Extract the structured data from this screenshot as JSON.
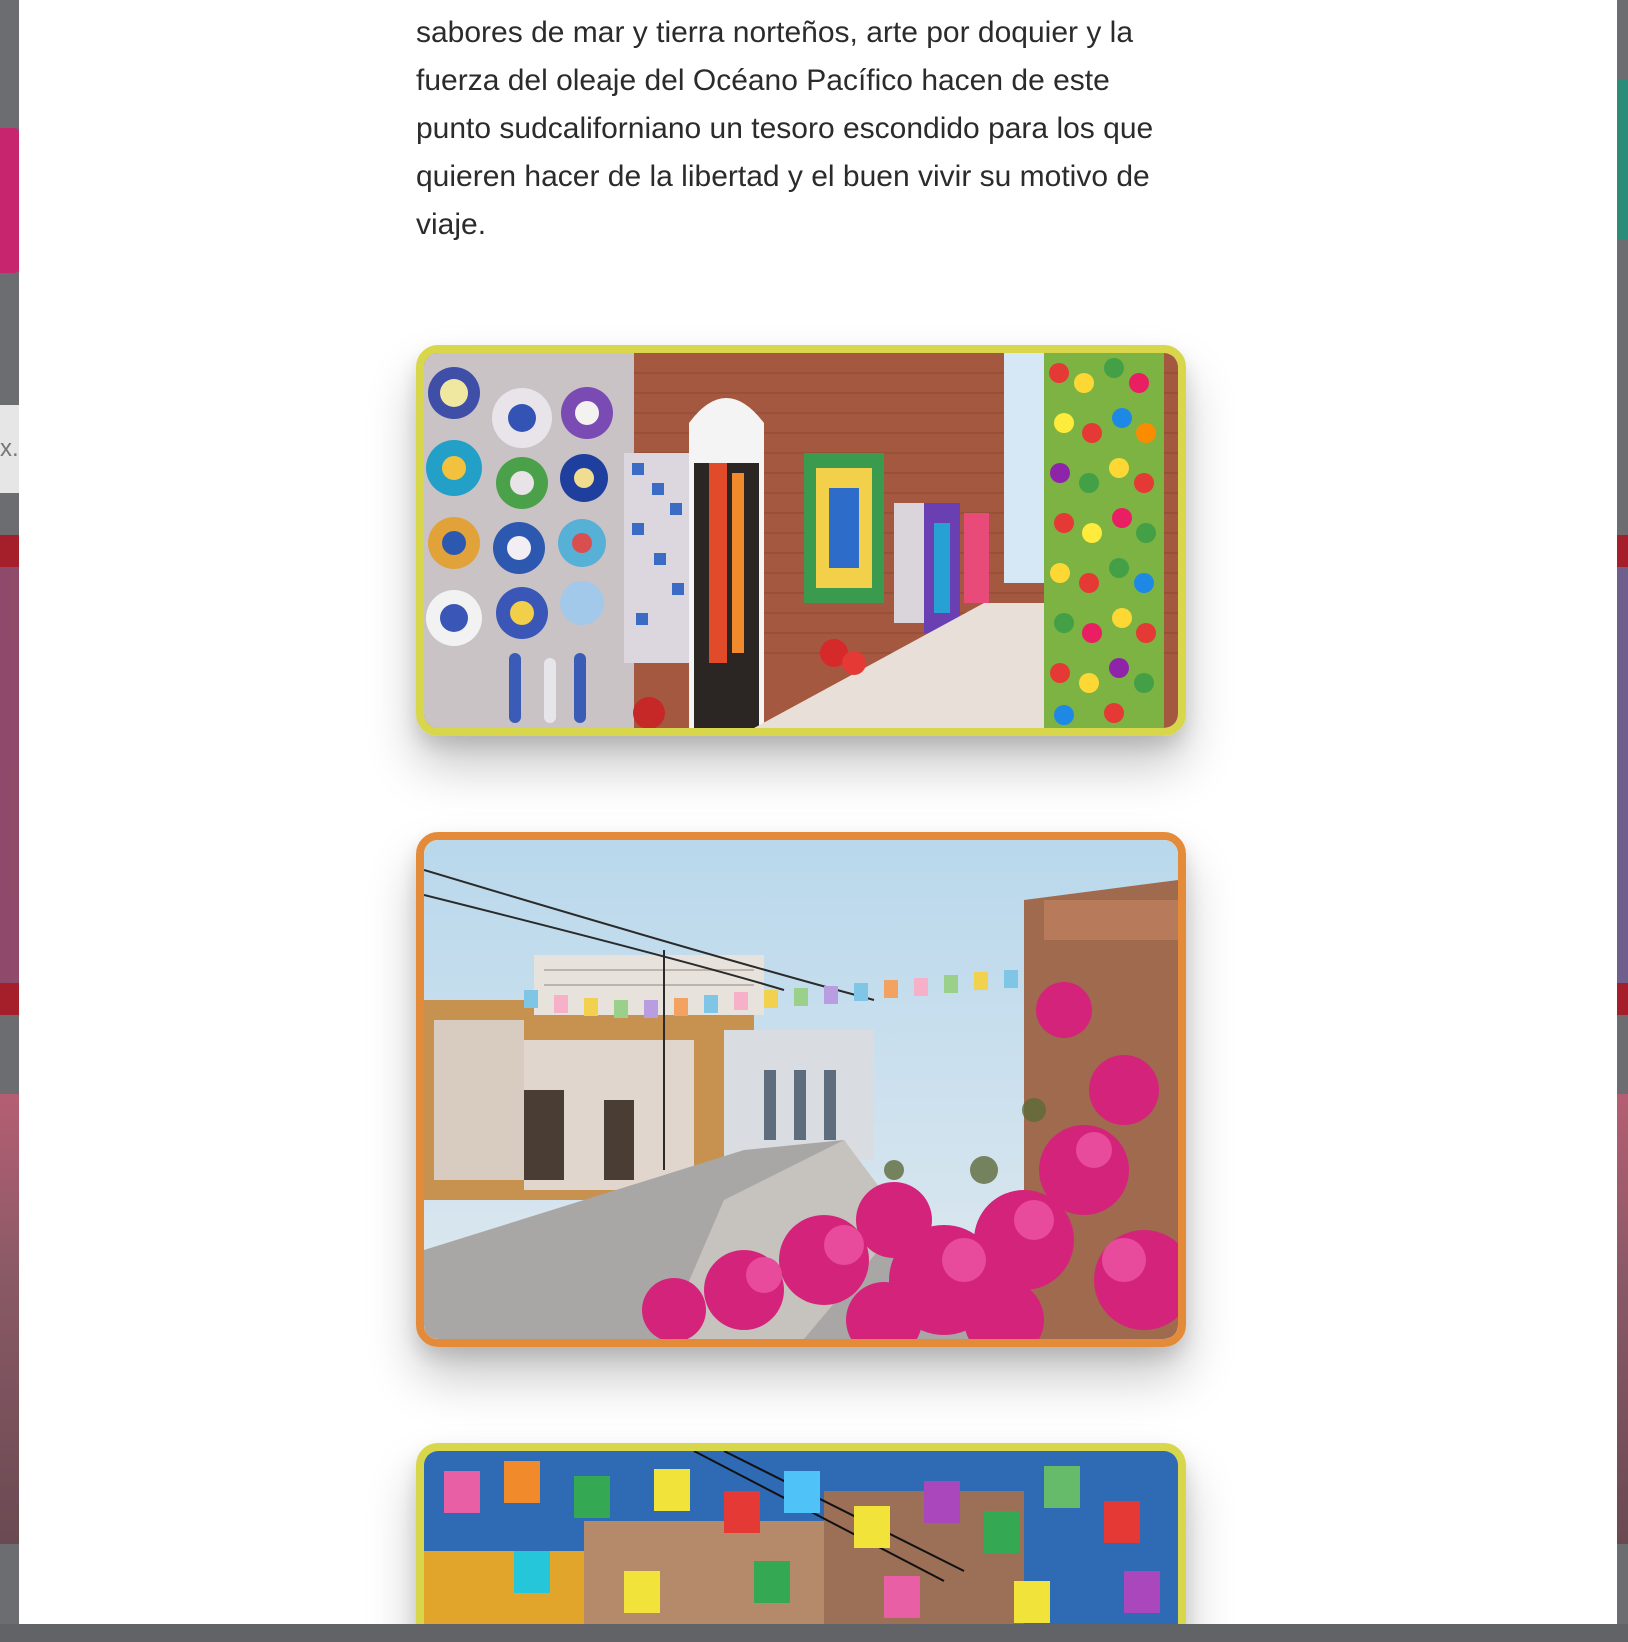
{
  "article": {
    "paragraph": "sabores de mar y tierra norteños, arte por doquier y la fuerza del oleaje del Océano Pacífico hacen de este punto sudcaliforniano un tesoro escondido para los que quieren hacer de la libertad y el buen vivir su motivo de viaje."
  },
  "backdrop": {
    "search_fragment": "x."
  },
  "photos": [
    {
      "alt": "Fachada de ladrillo con artesanías, platos de talavera y pompones de colores",
      "border": "#d8d64a"
    },
    {
      "alt": "Calle con papel picado y bugambilias fucsias",
      "border": "#e48b3a"
    },
    {
      "alt": "Papel picado de colores sobre fachadas",
      "border": "#d8d64a"
    }
  ],
  "colors": {
    "text": "#2b2b2b",
    "border_yellow": "#d8d64a",
    "border_orange": "#e48b3a",
    "overlay": "#6b6d70"
  }
}
